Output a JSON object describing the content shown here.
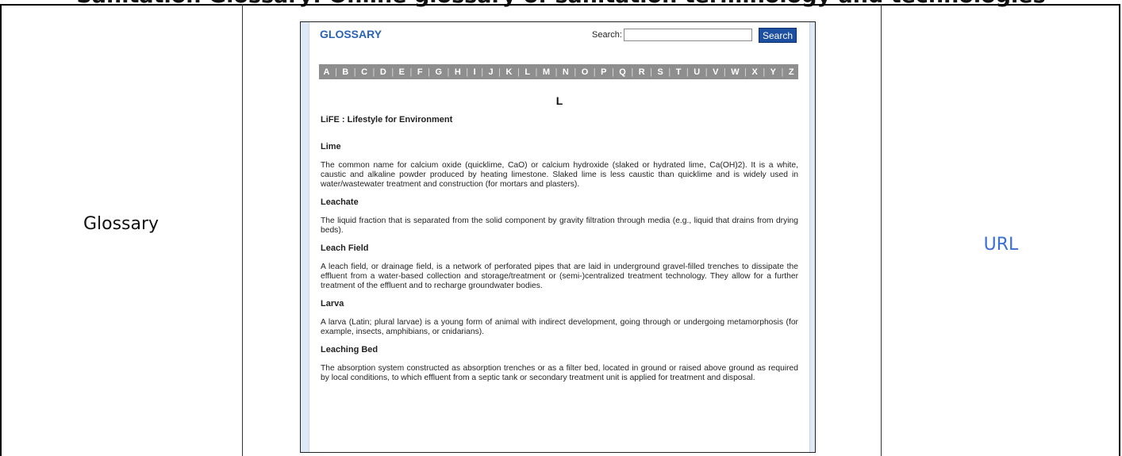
{
  "page_header": "Sanitation Glossary: Online glossary of sanitation terminology and technologies",
  "table_row": {
    "label": "Glossary",
    "link_text": "URL"
  },
  "glossary_screenshot": {
    "title": "GLOSSARY",
    "search": {
      "label": "Search:",
      "value": "",
      "button": "Search"
    },
    "alphabet": [
      "A",
      "B",
      "C",
      "D",
      "E",
      "F",
      "G",
      "H",
      "I",
      "J",
      "K",
      "L",
      "M",
      "N",
      "O",
      "P",
      "Q",
      "R",
      "S",
      "T",
      "U",
      "V",
      "W",
      "X",
      "Y",
      "Z"
    ],
    "current_letter": "L",
    "entries": [
      {
        "term": "LiFE : Lifestyle for Environment",
        "definition": ""
      },
      {
        "term": "Lime",
        "definition": "The common name for calcium oxide (quicklime, CaO) or calcium hydroxide (slaked or hydrated lime, Ca(OH)2). It is a white, caustic and alkaline powder produced by heating limestone. Slaked lime is less caustic than quicklime and is widely used in water/wastewater treatment and construction (for mortars and plasters)."
      },
      {
        "term": "Leachate",
        "definition": "The liquid fraction that is separated from the solid component by gravity filtration through media (e.g., liquid that drains from drying beds)."
      },
      {
        "term": "Leach Field",
        "definition": "A leach field, or drainage field, is a network of perforated pipes that are laid in underground gravel-filled trenches to dissipate the effluent from a water-based collection and storage/treatment or (semi-)centralized treatment technology. They allow for a further treatment of the effluent and to recharge groundwater bodies."
      },
      {
        "term": "Larva",
        "definition": "A larva (Latin; plural larvae) is a young form of animal with indirect development, going through or undergoing metamorphosis (for example, insects, amphibians, or cnidarians)."
      },
      {
        "term": "Leaching Bed",
        "definition": "The absorption system constructed as absorption trenches or as a filter bed, located in ground or raised above ground as required by local conditions, to which effluent from a septic tank or secondary treatment unit is applied for treatment and disposal."
      }
    ]
  }
}
